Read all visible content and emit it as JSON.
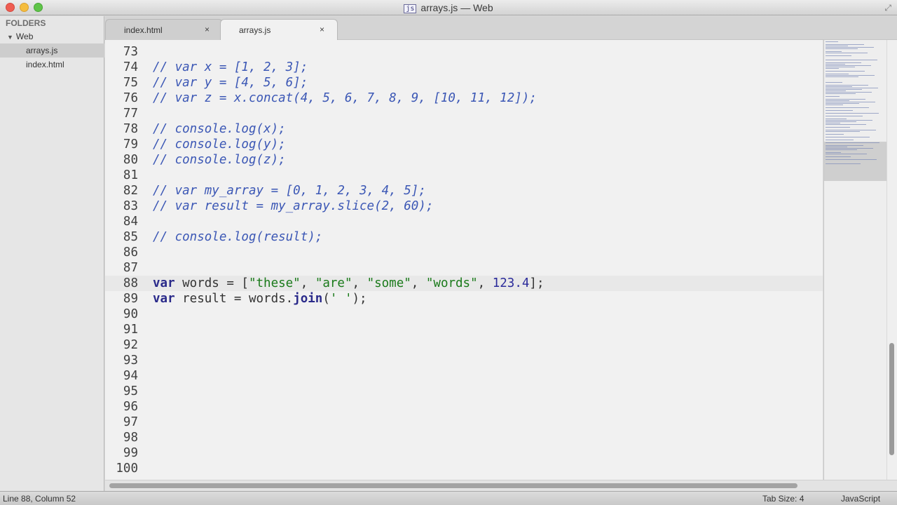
{
  "window": {
    "title": "arrays.js — Web",
    "file_type_badge": "js"
  },
  "sidebar": {
    "header": "FOLDERS",
    "folder": "Web",
    "files": [
      {
        "label": "arrays.js",
        "selected": true
      },
      {
        "label": "index.html",
        "selected": false
      }
    ]
  },
  "tabs": [
    {
      "label": "index.html",
      "close": "×",
      "active": false
    },
    {
      "label": "arrays.js",
      "close": "×",
      "active": true
    }
  ],
  "editor": {
    "current_line": 88,
    "lines": [
      {
        "n": "73",
        "tokens": []
      },
      {
        "n": "74",
        "tokens": [
          {
            "t": "cmt",
            "v": "// var x = [1, 2, 3];"
          }
        ]
      },
      {
        "n": "75",
        "tokens": [
          {
            "t": "cmt",
            "v": "// var y = [4, 5, 6];"
          }
        ]
      },
      {
        "n": "76",
        "tokens": [
          {
            "t": "cmt",
            "v": "// var z = x.concat(4, 5, 6, 7, 8, 9, [10, 11, 12]);"
          }
        ]
      },
      {
        "n": "77",
        "tokens": []
      },
      {
        "n": "78",
        "tokens": [
          {
            "t": "cmt",
            "v": "// console.log(x);"
          }
        ]
      },
      {
        "n": "79",
        "tokens": [
          {
            "t": "cmt",
            "v": "// console.log(y);"
          }
        ]
      },
      {
        "n": "80",
        "tokens": [
          {
            "t": "cmt",
            "v": "// console.log(z);"
          }
        ]
      },
      {
        "n": "81",
        "tokens": []
      },
      {
        "n": "82",
        "tokens": [
          {
            "t": "cmt",
            "v": "// var my_array = [0, 1, 2, 3, 4, 5];"
          }
        ]
      },
      {
        "n": "83",
        "tokens": [
          {
            "t": "cmt",
            "v": "// var result = my_array.slice(2, 60);"
          }
        ]
      },
      {
        "n": "84",
        "tokens": []
      },
      {
        "n": "85",
        "tokens": [
          {
            "t": "cmt",
            "v": "// console.log(result);"
          }
        ]
      },
      {
        "n": "86",
        "tokens": []
      },
      {
        "n": "87",
        "tokens": []
      },
      {
        "n": "88",
        "tokens": [
          {
            "t": "kw",
            "v": "var"
          },
          {
            "t": "plain",
            "v": " words = ["
          },
          {
            "t": "str",
            "v": "\"these\""
          },
          {
            "t": "plain",
            "v": ", "
          },
          {
            "t": "str",
            "v": "\"are\""
          },
          {
            "t": "plain",
            "v": ", "
          },
          {
            "t": "str",
            "v": "\"some\""
          },
          {
            "t": "plain",
            "v": ", "
          },
          {
            "t": "str",
            "v": "\"words\""
          },
          {
            "t": "plain",
            "v": ", "
          },
          {
            "t": "num",
            "v": "123.4"
          },
          {
            "t": "plain",
            "v": "];"
          }
        ]
      },
      {
        "n": "89",
        "tokens": [
          {
            "t": "kw",
            "v": "var"
          },
          {
            "t": "plain",
            "v": " result = words."
          },
          {
            "t": "kw",
            "v": "join"
          },
          {
            "t": "plain",
            "v": "("
          },
          {
            "t": "str",
            "v": "' '"
          },
          {
            "t": "plain",
            "v": ");"
          }
        ]
      },
      {
        "n": "90",
        "tokens": []
      },
      {
        "n": "91",
        "tokens": []
      },
      {
        "n": "92",
        "tokens": []
      },
      {
        "n": "93",
        "tokens": []
      },
      {
        "n": "94",
        "tokens": []
      },
      {
        "n": "95",
        "tokens": []
      },
      {
        "n": "96",
        "tokens": []
      },
      {
        "n": "97",
        "tokens": []
      },
      {
        "n": "98",
        "tokens": []
      },
      {
        "n": "99",
        "tokens": []
      },
      {
        "n": "100",
        "tokens": []
      }
    ]
  },
  "status": {
    "position": "Line 88, Column 52",
    "tab_size": "Tab Size: 4",
    "syntax": "JavaScript"
  }
}
